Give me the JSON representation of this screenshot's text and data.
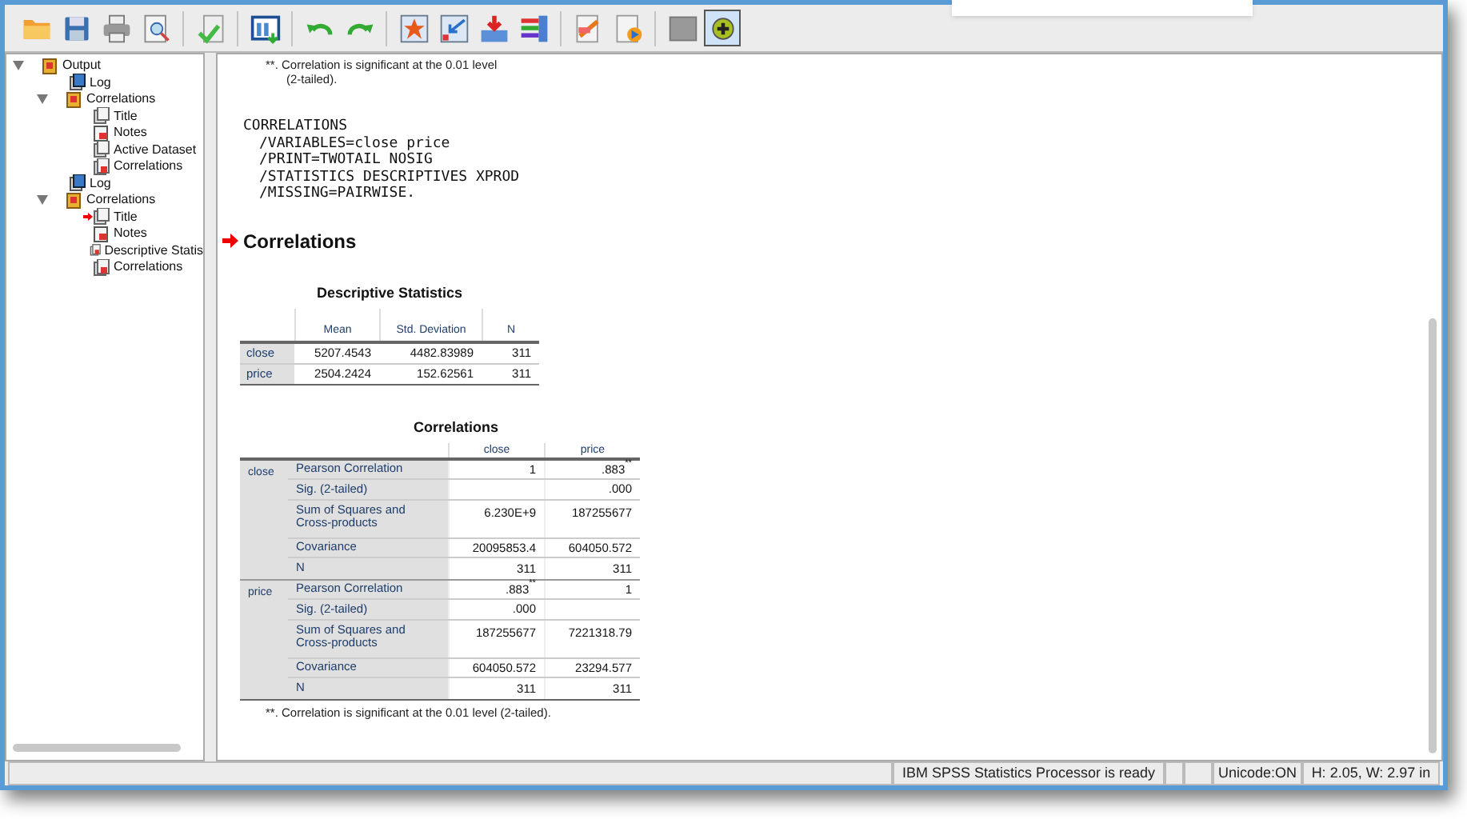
{
  "toolbar": {
    "buttons": [
      {
        "selected": false
      },
      {
        "selected": false
      },
      {
        "selected": false
      },
      {
        "selected": false
      },
      {
        "selected": false
      },
      {
        "selected": false
      },
      {
        "selected": false
      },
      {
        "selected": false
      },
      {
        "selected": false
      },
      {
        "selected": false
      },
      {
        "selected": false
      },
      {
        "selected": false
      },
      {
        "selected": false
      },
      {
        "selected": false
      },
      {
        "selected": false
      },
      {
        "selected": true
      }
    ]
  },
  "outline": [
    {
      "label": "Output",
      "kind": "book",
      "current": false,
      "expanded": true,
      "children": [
        {
          "label": "Log",
          "kind": "log",
          "current": false
        },
        {
          "label": "Correlations",
          "kind": "book",
          "current": false,
          "expanded": true,
          "children": [
            {
              "label": "Title",
              "kind": "title",
              "current": false
            },
            {
              "label": "Notes",
              "kind": "notes",
              "current": false
            },
            {
              "label": "Active Dataset",
              "kind": "title",
              "current": false
            },
            {
              "label": "Correlations",
              "kind": "table",
              "current": false
            }
          ]
        },
        {
          "label": "Log",
          "kind": "log",
          "current": false
        },
        {
          "label": "Correlations",
          "kind": "book",
          "current": false,
          "expanded": true,
          "children": [
            {
              "label": "Title",
              "kind": "title",
              "current": true
            },
            {
              "label": "Notes",
              "kind": "notes",
              "current": false
            },
            {
              "label": "Descriptive Statis",
              "kind": "table",
              "current": false
            },
            {
              "label": "Correlations",
              "kind": "table",
              "current": false
            }
          ]
        }
      ]
    }
  ],
  "output": {
    "top_footnote": [
      "**. Correlation is significant at the 0.01 level",
      "(2-tailed)."
    ],
    "syntax": [
      "CORRELATIONS",
      "/VARIABLES=close price",
      "/PRINT=TWOTAIL NOSIG",
      "/STATISTICS DESCRIPTIVES XPROD",
      "/MISSING=PAIRWISE."
    ],
    "heading": {
      "text": "Correlations",
      "current": true
    },
    "descriptives": {
      "title": "Descriptive Statistics",
      "columns": [
        "Mean",
        "Std. Deviation",
        "N"
      ],
      "rows": [
        {
          "label": "close",
          "cells": [
            "5207.4543",
            "4482.83989",
            "311"
          ]
        },
        {
          "label": "price",
          "cells": [
            "2504.2424",
            "152.62561",
            "311"
          ]
        }
      ]
    },
    "correlations": {
      "title": "Correlations",
      "columns": [
        "close",
        "price"
      ],
      "groups": [
        {
          "label": "close",
          "rows": [
            {
              "label": "Pearson Correlation",
              "cells": [
                "1",
                ".883$^{**}$"
              ]
            },
            {
              "label": "Sig. (2-tailed)",
              "cells": [
                "",
                ".000"
              ]
            },
            {
              "label": "Sum of Squares and Cross-products",
              "cells": [
                "6.230E+9",
                "187255677"
              ]
            },
            {
              "label": "Covariance",
              "cells": [
                "20095853.4",
                "604050.572"
              ]
            },
            {
              "label": "N",
              "cells": [
                "311",
                "311"
              ]
            }
          ]
        },
        {
          "label": "price",
          "rows": [
            {
              "label": "Pearson Correlation",
              "cells": [
                ".883$^{**}$",
                "1"
              ]
            },
            {
              "label": "Sig. (2-tailed)",
              "cells": [
                ".000",
                ""
              ]
            },
            {
              "label": "Sum of Squares and Cross-products",
              "cells": [
                "187255677",
                "7221318.79"
              ]
            },
            {
              "label": "Covariance",
              "cells": [
                "604050.572",
                "23294.577"
              ]
            },
            {
              "label": "N",
              "cells": [
                "311",
                "311"
              ]
            }
          ]
        }
      ],
      "footnote": "**. Correlation is significant at the 0.01 level (2-tailed)."
    }
  },
  "status_bar": [
    "IBM SPSS Statistics Processor is ready",
    "Unicode:ON",
    "H: 2.05, W: 2.97 in"
  ]
}
